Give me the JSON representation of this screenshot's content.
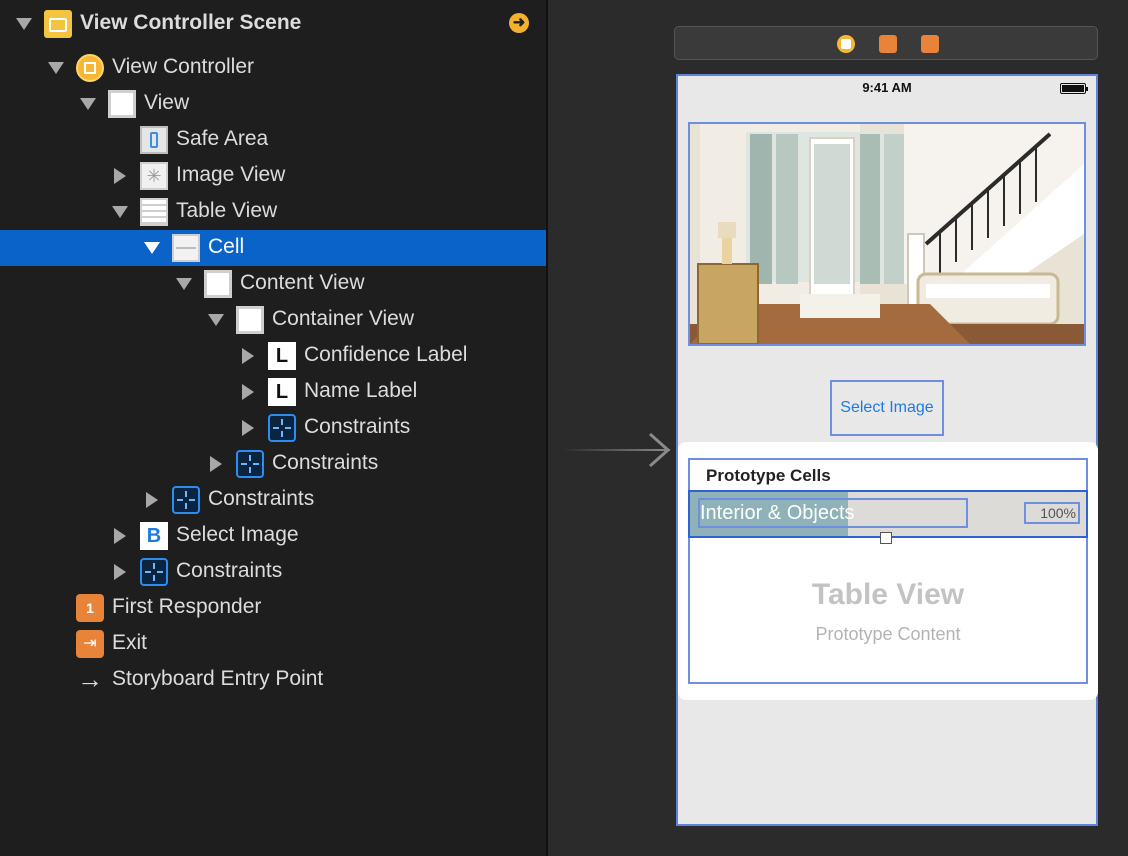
{
  "outline": {
    "scene_title": "View Controller Scene",
    "items": [
      {
        "label": "View Controller",
        "icon": "view-controller-icon"
      },
      {
        "label": "View",
        "icon": "view-icon"
      },
      {
        "label": "Safe Area",
        "icon": "safe-area-icon"
      },
      {
        "label": "Image View",
        "icon": "image-view-icon"
      },
      {
        "label": "Table View",
        "icon": "table-view-icon"
      },
      {
        "label": "Cell",
        "icon": "table-cell-icon"
      },
      {
        "label": "Content View",
        "icon": "view-icon"
      },
      {
        "label": "Container View",
        "icon": "view-icon"
      },
      {
        "label": "Confidence Label",
        "icon": "label-icon"
      },
      {
        "label": "Name Label",
        "icon": "label-icon"
      },
      {
        "label": "Constraints",
        "icon": "constraints-icon"
      },
      {
        "label": "Constraints",
        "icon": "constraints-icon"
      },
      {
        "label": "Constraints",
        "icon": "constraints-icon"
      },
      {
        "label": "Select Image",
        "icon": "button-icon"
      },
      {
        "label": "Constraints",
        "icon": "constraints-icon"
      },
      {
        "label": "First Responder",
        "icon": "first-responder-icon"
      },
      {
        "label": "Exit",
        "icon": "exit-icon"
      },
      {
        "label": "Storyboard Entry Point",
        "icon": "arrow-right-icon"
      }
    ],
    "label_glyph": "L",
    "button_glyph": "B",
    "first_responder_glyph": "1"
  },
  "canvas": {
    "status_time": "9:41 AM",
    "select_image_button": "Select Image",
    "table": {
      "header": "Prototype Cells",
      "cell_name": "Interior & Objects",
      "cell_confidence": "100%",
      "cell_progress": 0.4,
      "title": "Table View",
      "subtitle": "Prototype Content"
    }
  },
  "colors": {
    "selection": "#0a63c9",
    "outline_bg": "#1e1e1e",
    "canvas_bg": "#2b2b2b",
    "accent_blue": "#1f7ae0",
    "constraint_blue": "#2c8ef0"
  }
}
